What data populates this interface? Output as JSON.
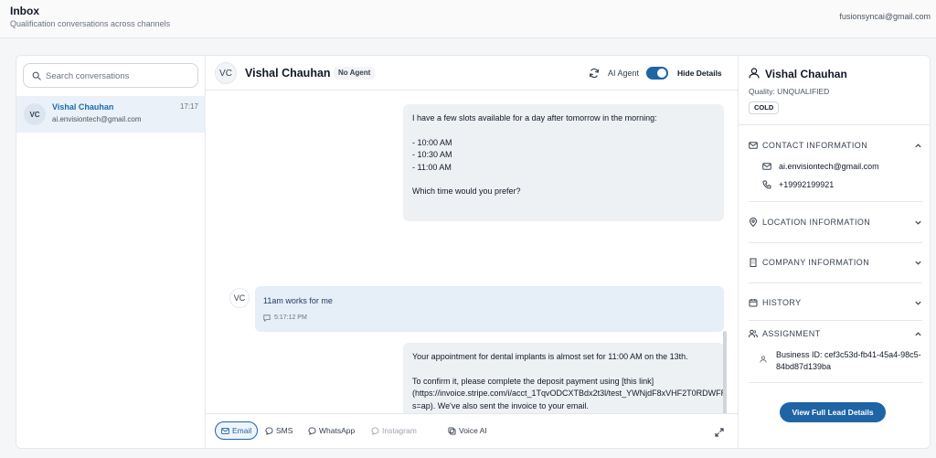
{
  "header": {
    "title": "Inbox",
    "subtitle": "Qualification conversations across channels",
    "user_email": "fusionsyncai@gmail.com"
  },
  "sidebar": {
    "search_placeholder": "Search conversations",
    "conversations": [
      {
        "initials": "VC",
        "name": "Vishal Chauhan",
        "email": "ai.envisiontech@gmail.com",
        "time": "17:17"
      }
    ]
  },
  "chat": {
    "initials": "VC",
    "contact_name": "Vishal Chauhan",
    "agent_badge": "No Agent",
    "ai_agent_label": "AI Agent",
    "ai_agent_enabled": true,
    "hide_details_label": "Hide Details",
    "messages": [
      {
        "direction": "outgoing",
        "text": "I have a few slots available for a day after tomorrow in the morning:\n\n- 10:00 AM\n- 10:30 AM\n- 11:00 AM\n\nWhich time would you prefer?"
      },
      {
        "direction": "incoming",
        "initials": "VC",
        "text": "11am works for me",
        "time": "5:17:12 PM"
      },
      {
        "direction": "outgoing",
        "text": "Your appointment for dental implants is almost set for 11:00 AM on the 13th.\n\nTo confirm it, please complete the deposit payment using [this link](https://invoice.stripe.com/i/acct_1TqvODCXTBdx2t3l/test_YWNjdF8xVHF2T0RDWFRCZHgydDNsLF9UeXF2VEk4a1NueFlOLDE3NDMxMTIzOA0200UiocIPx3?s=ap). We've also sent the invoice to your email.\n\nLet me know if you need any help!"
      }
    ],
    "channels": [
      {
        "label": "Email",
        "icon": "mail-icon",
        "state": "active"
      },
      {
        "label": "SMS",
        "icon": "chat-bubble-icon",
        "state": "enabled"
      },
      {
        "label": "WhatsApp",
        "icon": "whatsapp-icon",
        "state": "enabled"
      },
      {
        "label": "Instagram",
        "icon": "instagram-icon",
        "state": "disabled"
      },
      {
        "label": "Voice AI",
        "icon": "phone-icon",
        "state": "enabled"
      }
    ]
  },
  "lead": {
    "name": "Vishal Chauhan",
    "quality": "Quality: UNQUALIFIED",
    "temperature": "COLD",
    "sections": {
      "contact": {
        "label": "CONTACT INFORMATION",
        "expanded": true,
        "email": "ai.envisiontech@gmail.com",
        "phone": "+19992199921"
      },
      "location": {
        "label": "LOCATION INFORMATION",
        "expanded": false
      },
      "company": {
        "label": "COMPANY INFORMATION",
        "expanded": false
      },
      "history": {
        "label": "HISTORY",
        "expanded": false
      },
      "assignment": {
        "label": "ASSIGNMENT",
        "expanded": true,
        "business_id": "Business ID: cef3c53d-fb41-45a4-98c5-84bd87d139ba"
      }
    },
    "view_button_label": "View Full Lead Details"
  },
  "colors": {
    "accent": "#1f64a4",
    "selected_row": "#eaf1f8",
    "outgoing_bubble": "#eef1f4",
    "incoming_bubble": "#e6eef7"
  }
}
